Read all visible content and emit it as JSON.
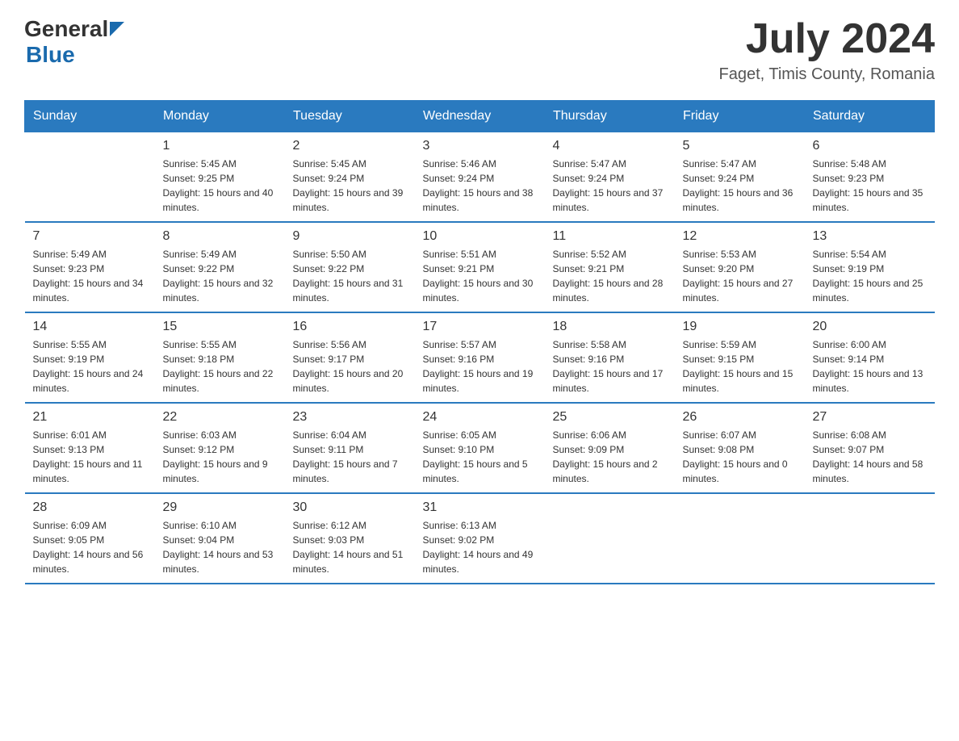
{
  "header": {
    "logo_general": "General",
    "logo_blue": "Blue",
    "month_year": "July 2024",
    "location": "Faget, Timis County, Romania"
  },
  "days_of_week": [
    "Sunday",
    "Monday",
    "Tuesday",
    "Wednesday",
    "Thursday",
    "Friday",
    "Saturday"
  ],
  "weeks": [
    [
      {
        "day": "",
        "sunrise": "",
        "sunset": "",
        "daylight": ""
      },
      {
        "day": "1",
        "sunrise": "Sunrise: 5:45 AM",
        "sunset": "Sunset: 9:25 PM",
        "daylight": "Daylight: 15 hours and 40 minutes."
      },
      {
        "day": "2",
        "sunrise": "Sunrise: 5:45 AM",
        "sunset": "Sunset: 9:24 PM",
        "daylight": "Daylight: 15 hours and 39 minutes."
      },
      {
        "day": "3",
        "sunrise": "Sunrise: 5:46 AM",
        "sunset": "Sunset: 9:24 PM",
        "daylight": "Daylight: 15 hours and 38 minutes."
      },
      {
        "day": "4",
        "sunrise": "Sunrise: 5:47 AM",
        "sunset": "Sunset: 9:24 PM",
        "daylight": "Daylight: 15 hours and 37 minutes."
      },
      {
        "day": "5",
        "sunrise": "Sunrise: 5:47 AM",
        "sunset": "Sunset: 9:24 PM",
        "daylight": "Daylight: 15 hours and 36 minutes."
      },
      {
        "day": "6",
        "sunrise": "Sunrise: 5:48 AM",
        "sunset": "Sunset: 9:23 PM",
        "daylight": "Daylight: 15 hours and 35 minutes."
      }
    ],
    [
      {
        "day": "7",
        "sunrise": "Sunrise: 5:49 AM",
        "sunset": "Sunset: 9:23 PM",
        "daylight": "Daylight: 15 hours and 34 minutes."
      },
      {
        "day": "8",
        "sunrise": "Sunrise: 5:49 AM",
        "sunset": "Sunset: 9:22 PM",
        "daylight": "Daylight: 15 hours and 32 minutes."
      },
      {
        "day": "9",
        "sunrise": "Sunrise: 5:50 AM",
        "sunset": "Sunset: 9:22 PM",
        "daylight": "Daylight: 15 hours and 31 minutes."
      },
      {
        "day": "10",
        "sunrise": "Sunrise: 5:51 AM",
        "sunset": "Sunset: 9:21 PM",
        "daylight": "Daylight: 15 hours and 30 minutes."
      },
      {
        "day": "11",
        "sunrise": "Sunrise: 5:52 AM",
        "sunset": "Sunset: 9:21 PM",
        "daylight": "Daylight: 15 hours and 28 minutes."
      },
      {
        "day": "12",
        "sunrise": "Sunrise: 5:53 AM",
        "sunset": "Sunset: 9:20 PM",
        "daylight": "Daylight: 15 hours and 27 minutes."
      },
      {
        "day": "13",
        "sunrise": "Sunrise: 5:54 AM",
        "sunset": "Sunset: 9:19 PM",
        "daylight": "Daylight: 15 hours and 25 minutes."
      }
    ],
    [
      {
        "day": "14",
        "sunrise": "Sunrise: 5:55 AM",
        "sunset": "Sunset: 9:19 PM",
        "daylight": "Daylight: 15 hours and 24 minutes."
      },
      {
        "day": "15",
        "sunrise": "Sunrise: 5:55 AM",
        "sunset": "Sunset: 9:18 PM",
        "daylight": "Daylight: 15 hours and 22 minutes."
      },
      {
        "day": "16",
        "sunrise": "Sunrise: 5:56 AM",
        "sunset": "Sunset: 9:17 PM",
        "daylight": "Daylight: 15 hours and 20 minutes."
      },
      {
        "day": "17",
        "sunrise": "Sunrise: 5:57 AM",
        "sunset": "Sunset: 9:16 PM",
        "daylight": "Daylight: 15 hours and 19 minutes."
      },
      {
        "day": "18",
        "sunrise": "Sunrise: 5:58 AM",
        "sunset": "Sunset: 9:16 PM",
        "daylight": "Daylight: 15 hours and 17 minutes."
      },
      {
        "day": "19",
        "sunrise": "Sunrise: 5:59 AM",
        "sunset": "Sunset: 9:15 PM",
        "daylight": "Daylight: 15 hours and 15 minutes."
      },
      {
        "day": "20",
        "sunrise": "Sunrise: 6:00 AM",
        "sunset": "Sunset: 9:14 PM",
        "daylight": "Daylight: 15 hours and 13 minutes."
      }
    ],
    [
      {
        "day": "21",
        "sunrise": "Sunrise: 6:01 AM",
        "sunset": "Sunset: 9:13 PM",
        "daylight": "Daylight: 15 hours and 11 minutes."
      },
      {
        "day": "22",
        "sunrise": "Sunrise: 6:03 AM",
        "sunset": "Sunset: 9:12 PM",
        "daylight": "Daylight: 15 hours and 9 minutes."
      },
      {
        "day": "23",
        "sunrise": "Sunrise: 6:04 AM",
        "sunset": "Sunset: 9:11 PM",
        "daylight": "Daylight: 15 hours and 7 minutes."
      },
      {
        "day": "24",
        "sunrise": "Sunrise: 6:05 AM",
        "sunset": "Sunset: 9:10 PM",
        "daylight": "Daylight: 15 hours and 5 minutes."
      },
      {
        "day": "25",
        "sunrise": "Sunrise: 6:06 AM",
        "sunset": "Sunset: 9:09 PM",
        "daylight": "Daylight: 15 hours and 2 minutes."
      },
      {
        "day": "26",
        "sunrise": "Sunrise: 6:07 AM",
        "sunset": "Sunset: 9:08 PM",
        "daylight": "Daylight: 15 hours and 0 minutes."
      },
      {
        "day": "27",
        "sunrise": "Sunrise: 6:08 AM",
        "sunset": "Sunset: 9:07 PM",
        "daylight": "Daylight: 14 hours and 58 minutes."
      }
    ],
    [
      {
        "day": "28",
        "sunrise": "Sunrise: 6:09 AM",
        "sunset": "Sunset: 9:05 PM",
        "daylight": "Daylight: 14 hours and 56 minutes."
      },
      {
        "day": "29",
        "sunrise": "Sunrise: 6:10 AM",
        "sunset": "Sunset: 9:04 PM",
        "daylight": "Daylight: 14 hours and 53 minutes."
      },
      {
        "day": "30",
        "sunrise": "Sunrise: 6:12 AM",
        "sunset": "Sunset: 9:03 PM",
        "daylight": "Daylight: 14 hours and 51 minutes."
      },
      {
        "day": "31",
        "sunrise": "Sunrise: 6:13 AM",
        "sunset": "Sunset: 9:02 PM",
        "daylight": "Daylight: 14 hours and 49 minutes."
      },
      {
        "day": "",
        "sunrise": "",
        "sunset": "",
        "daylight": ""
      },
      {
        "day": "",
        "sunrise": "",
        "sunset": "",
        "daylight": ""
      },
      {
        "day": "",
        "sunrise": "",
        "sunset": "",
        "daylight": ""
      }
    ]
  ]
}
